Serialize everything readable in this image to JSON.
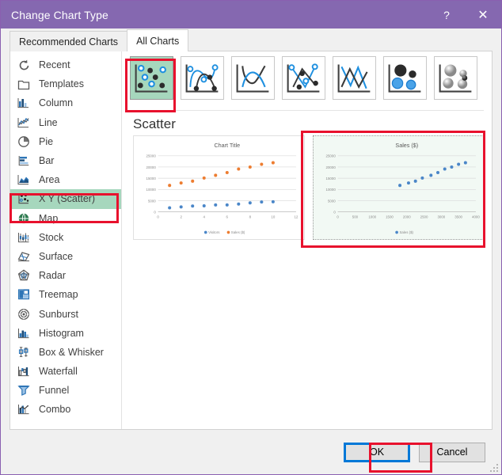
{
  "window": {
    "title": "Change Chart Type",
    "help_label": "?",
    "close_label": "✕"
  },
  "tabs": [
    {
      "label": "Recommended Charts",
      "active": false
    },
    {
      "label": "All Charts",
      "active": true
    }
  ],
  "sidebar": {
    "items": [
      {
        "label": "Recent",
        "icon": "recent-icon",
        "selected": false
      },
      {
        "label": "Templates",
        "icon": "templates-icon",
        "selected": false
      },
      {
        "label": "Column",
        "icon": "column-icon",
        "selected": false
      },
      {
        "label": "Line",
        "icon": "line-icon",
        "selected": false
      },
      {
        "label": "Pie",
        "icon": "pie-icon",
        "selected": false
      },
      {
        "label": "Bar",
        "icon": "bar-icon",
        "selected": false
      },
      {
        "label": "Area",
        "icon": "area-icon",
        "selected": false
      },
      {
        "label": "X Y (Scatter)",
        "icon": "scatter-icon",
        "selected": true
      },
      {
        "label": "Map",
        "icon": "map-icon",
        "selected": false
      },
      {
        "label": "Stock",
        "icon": "stock-icon",
        "selected": false
      },
      {
        "label": "Surface",
        "icon": "surface-icon",
        "selected": false
      },
      {
        "label": "Radar",
        "icon": "radar-icon",
        "selected": false
      },
      {
        "label": "Treemap",
        "icon": "treemap-icon",
        "selected": false
      },
      {
        "label": "Sunburst",
        "icon": "sunburst-icon",
        "selected": false
      },
      {
        "label": "Histogram",
        "icon": "histogram-icon",
        "selected": false
      },
      {
        "label": "Box & Whisker",
        "icon": "box-whisker-icon",
        "selected": false
      },
      {
        "label": "Waterfall",
        "icon": "waterfall-icon",
        "selected": false
      },
      {
        "label": "Funnel",
        "icon": "funnel-icon",
        "selected": false
      },
      {
        "label": "Combo",
        "icon": "combo-icon",
        "selected": false
      }
    ]
  },
  "gallery": {
    "title": "Scatter",
    "thumbnails": [
      {
        "name": "scatter",
        "selected": true
      },
      {
        "name": "scatter-with-smooth-lines-and-markers",
        "selected": false
      },
      {
        "name": "scatter-with-smooth-lines",
        "selected": false
      },
      {
        "name": "scatter-with-straight-lines-and-markers",
        "selected": false
      },
      {
        "name": "scatter-with-straight-lines",
        "selected": false
      },
      {
        "name": "bubble",
        "selected": false
      },
      {
        "name": "3d-bubble",
        "selected": false
      }
    ]
  },
  "chart_data": [
    {
      "id": "preview-left",
      "type": "scatter",
      "title": "Chart Title",
      "selected": false,
      "xlabel": "",
      "ylabel": "",
      "xlim": [
        0,
        12
      ],
      "xticks": [
        0,
        2,
        4,
        6,
        8,
        10,
        12
      ],
      "ylim": [
        0,
        25000
      ],
      "yticks": [
        0,
        5000,
        10000,
        15000,
        20000,
        25000
      ],
      "ytick_labels": [
        "0",
        "5000",
        "10000",
        "15000",
        "20000",
        "25000"
      ],
      "grid": true,
      "legend": "bottom",
      "series": [
        {
          "name": "Visitors",
          "color": "#4a86c8",
          "x": [
            1,
            2,
            3,
            4,
            5,
            6,
            7,
            8,
            9,
            10
          ],
          "y": [
            1800,
            2200,
            2600,
            2700,
            3100,
            3100,
            3500,
            4000,
            4400,
            4500
          ]
        },
        {
          "name": "Sales ($)",
          "color": "#ed7d31",
          "x": [
            1,
            2,
            3,
            4,
            5,
            6,
            7,
            8,
            9,
            10
          ],
          "y": [
            11800,
            12900,
            13700,
            15100,
            16300,
            17500,
            19100,
            20000,
            21200,
            21900
          ]
        }
      ]
    },
    {
      "id": "preview-right",
      "type": "scatter",
      "title": "Sales ($)",
      "selected": true,
      "xlabel": "",
      "ylabel": "",
      "xlim": [
        0,
        4000
      ],
      "xticks": [
        0,
        500,
        1000,
        1500,
        2000,
        2500,
        3000,
        3500,
        4000
      ],
      "xtick_labels": [
        "0",
        "500",
        "1000",
        "1500",
        "2000",
        "2500",
        "3000",
        "3500",
        "4000"
      ],
      "ylim": [
        0,
        25000
      ],
      "yticks": [
        0,
        5000,
        10000,
        15000,
        20000,
        25000
      ],
      "ytick_labels": [
        "0",
        "5000",
        "10000",
        "15000",
        "20000",
        "25000"
      ],
      "grid": true,
      "legend": "bottom",
      "series": [
        {
          "name": "Sales ($)",
          "color": "#4a86c8",
          "x": [
            1800,
            2050,
            2250,
            2450,
            2700,
            2900,
            3100,
            3300,
            3500,
            3700
          ],
          "y": [
            11800,
            12900,
            13700,
            15100,
            16300,
            17500,
            19100,
            20000,
            21200,
            21900
          ]
        }
      ]
    }
  ],
  "footer": {
    "ok_label": "OK",
    "cancel_label": "Cancel"
  },
  "colors": {
    "titlebar": "#8568b0",
    "selection_green": "#a6d7bd",
    "annotation_red": "#e8112d",
    "focus_blue": "#0078d7",
    "series_blue": "#4a86c8",
    "series_orange": "#ed7d31"
  }
}
